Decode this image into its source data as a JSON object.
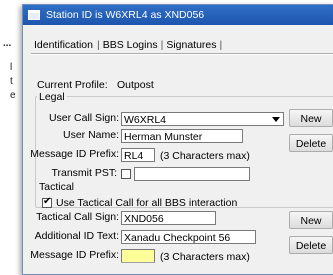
{
  "background": {
    "ellipsis": "...",
    "lines": [
      "l",
      "t",
      "e"
    ]
  },
  "window": {
    "title": "Station ID is W6XRL4 as XND056"
  },
  "tabs": [
    "Identification",
    "BBS Logins",
    "Signatures"
  ],
  "profile": {
    "label": "Current Profile:",
    "value": "Outpost"
  },
  "legal": {
    "group_label": "Legal",
    "call_sign_label": "User Call Sign:",
    "call_sign_value": "W6XRL4",
    "user_name_label": "User Name:",
    "user_name_value": "Herman Munster",
    "prefix_label": "Message ID Prefix:",
    "prefix_value": "RL4",
    "prefix_hint": "(3 Characters max)",
    "pst_label": "Transmit PST:",
    "pst_checked": false,
    "new_button": "New",
    "delete_button": "Delete"
  },
  "tactical": {
    "group_label": "Tactical",
    "use_label": "Use Tactical Call for all BBS interaction",
    "use_checked": true,
    "call_sign_label": "Tactical Call Sign:",
    "call_sign_value": "XND056",
    "additional_label": "Additional ID Text:",
    "additional_value": "Xanadu Checkpoint 56",
    "prefix_label": "Message ID Prefix:",
    "prefix_value": "",
    "prefix_hint": "(3 Characters max)",
    "prefix_color": "#ffff99",
    "new_button": "New",
    "delete_button": "Delete"
  }
}
